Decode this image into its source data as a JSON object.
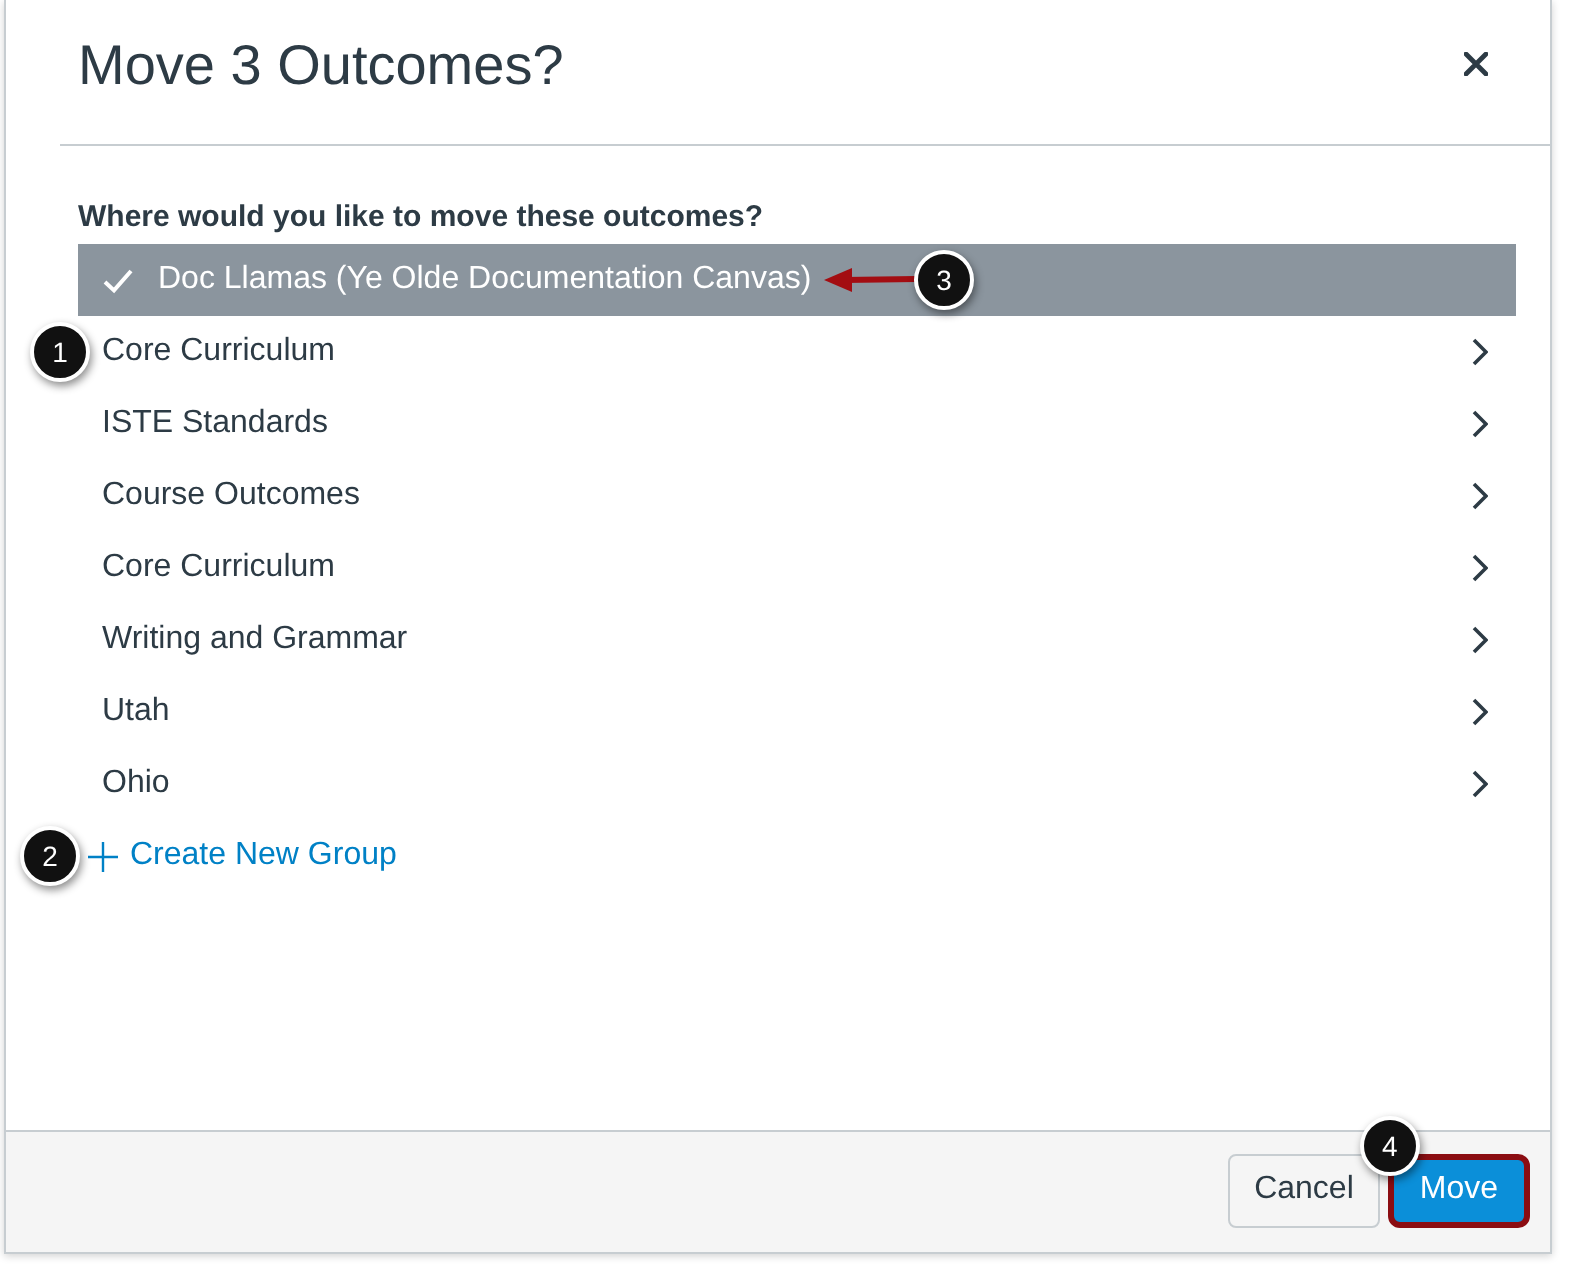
{
  "dialog": {
    "title": "Move 3 Outcomes?"
  },
  "prompt": "Where would you like to move these outcomes?",
  "groups": [
    {
      "label": "Doc Llamas (Ye Olde Documentation Canvas)",
      "selected": true,
      "expandable": false,
      "callout": {
        "number": "3",
        "kind": "arrow"
      }
    },
    {
      "label": "Core Curriculum",
      "selected": false,
      "expandable": true,
      "callout": {
        "number": "1",
        "kind": "badge"
      }
    },
    {
      "label": "ISTE Standards",
      "selected": false,
      "expandable": true
    },
    {
      "label": "Course Outcomes",
      "selected": false,
      "expandable": true
    },
    {
      "label": "Core Curriculum",
      "selected": false,
      "expandable": true
    },
    {
      "label": "Writing and Grammar",
      "selected": false,
      "expandable": true
    },
    {
      "label": "Utah",
      "selected": false,
      "expandable": true
    },
    {
      "label": "Ohio",
      "selected": false,
      "expandable": true
    }
  ],
  "create_link": {
    "label": "Create New Group",
    "callout": {
      "number": "2",
      "kind": "badge"
    }
  },
  "footer_buttons": [
    {
      "label": "Cancel",
      "kind": "secondary",
      "highlighted": false
    },
    {
      "label": "Move",
      "kind": "primary",
      "highlighted": true,
      "callout": {
        "number": "4",
        "kind": "badge"
      }
    }
  ]
}
